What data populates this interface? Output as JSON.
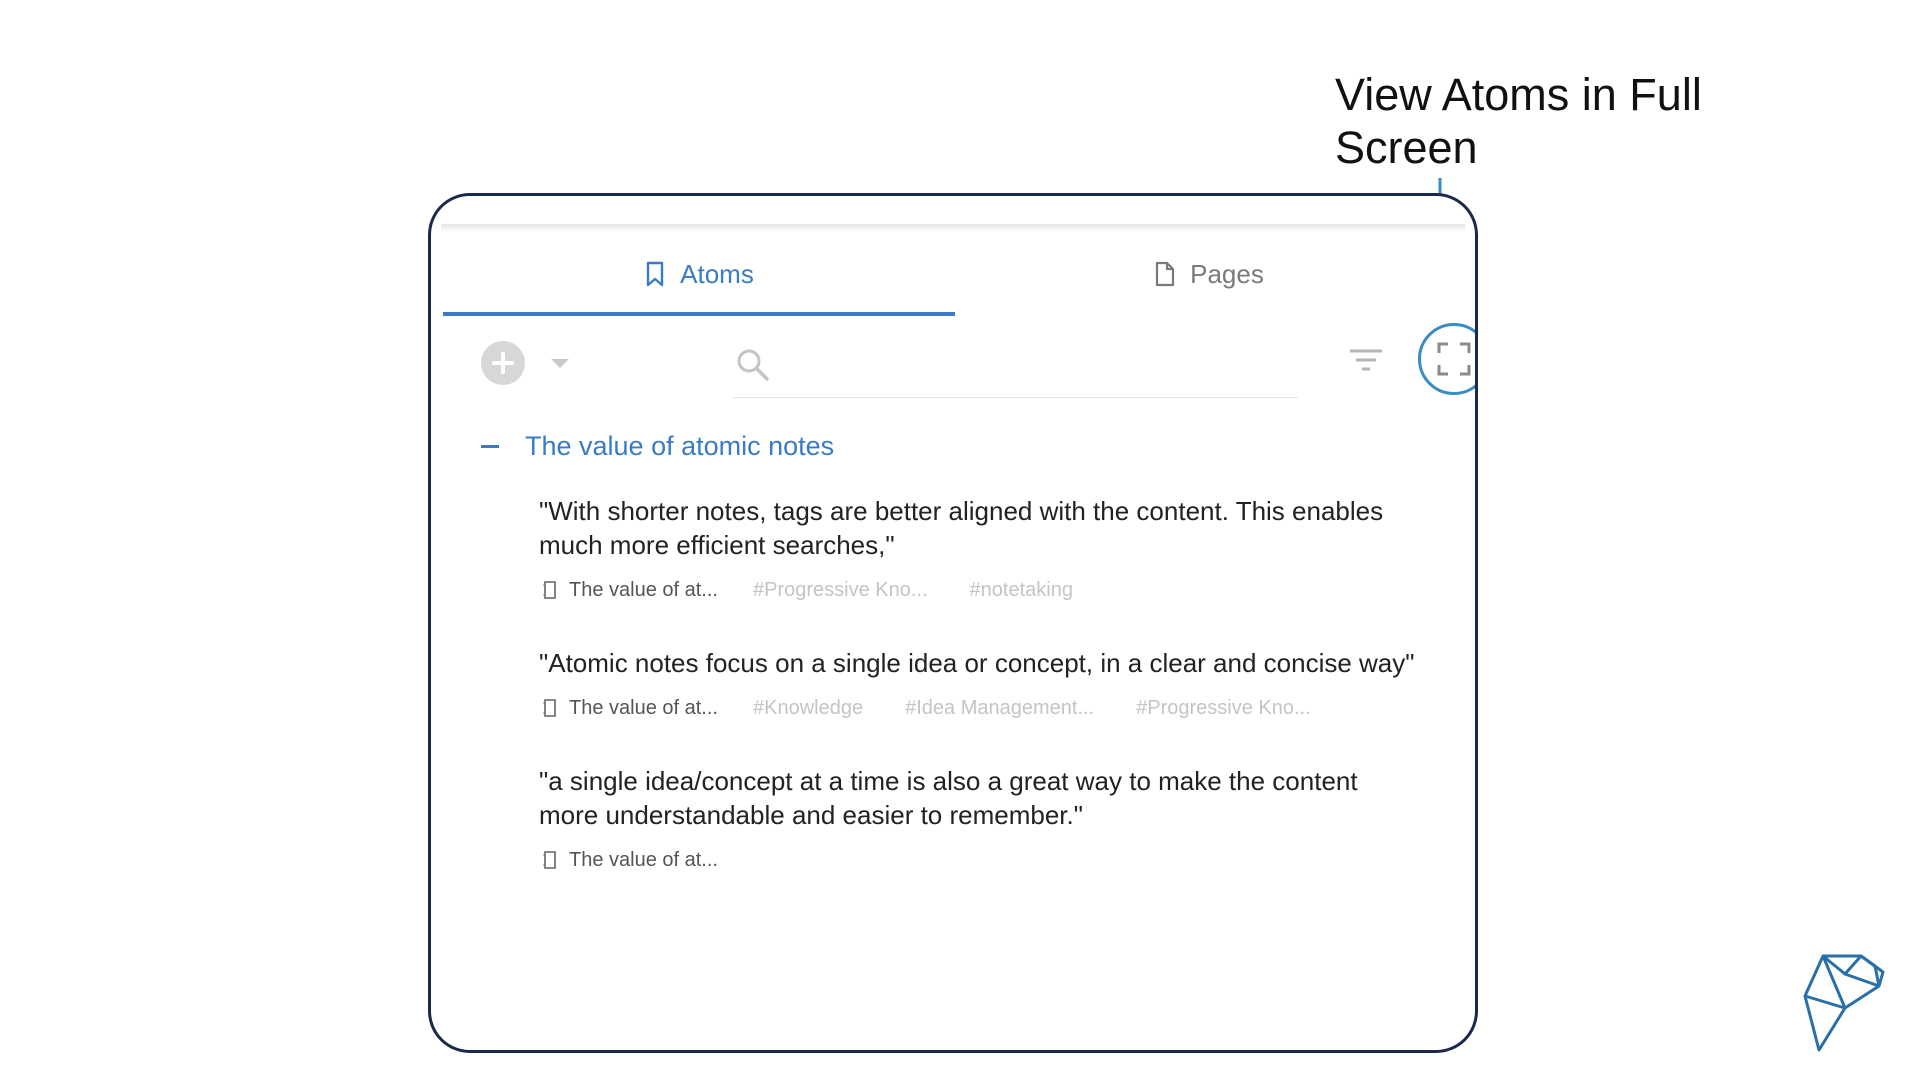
{
  "annotation": {
    "line1": "View Atoms in Full",
    "line2": "Screen"
  },
  "tabs": [
    {
      "label": "Atoms",
      "icon": "bookmark-icon",
      "active": true
    },
    {
      "label": "Pages",
      "icon": "page-icon",
      "active": false
    }
  ],
  "toolbar": {
    "search_placeholder": ""
  },
  "group": {
    "title": "The value of atomic notes"
  },
  "atoms": [
    {
      "text": "\"With shorter notes, tags are better aligned with the content. This enables much more efficient searches,\"",
      "source": "The value of at...",
      "tags": [
        "#Progressive Kno...",
        "#notetaking"
      ]
    },
    {
      "text": "\"Atomic notes focus on a single idea or concept, in a clear and concise way\"",
      "source": "The value of at...",
      "tags": [
        "#Knowledge",
        "#Idea Management...",
        "#Progressive Kno..."
      ]
    },
    {
      "text": "\"a single idea/concept at a time is also a great way to make the content more understandable and easier to remember.\"",
      "source": "The value of at...",
      "tags": []
    }
  ],
  "colors": {
    "accent": "#3a7bc6",
    "frame": "#1b2a4a",
    "highlight": "#3a8cc4"
  }
}
